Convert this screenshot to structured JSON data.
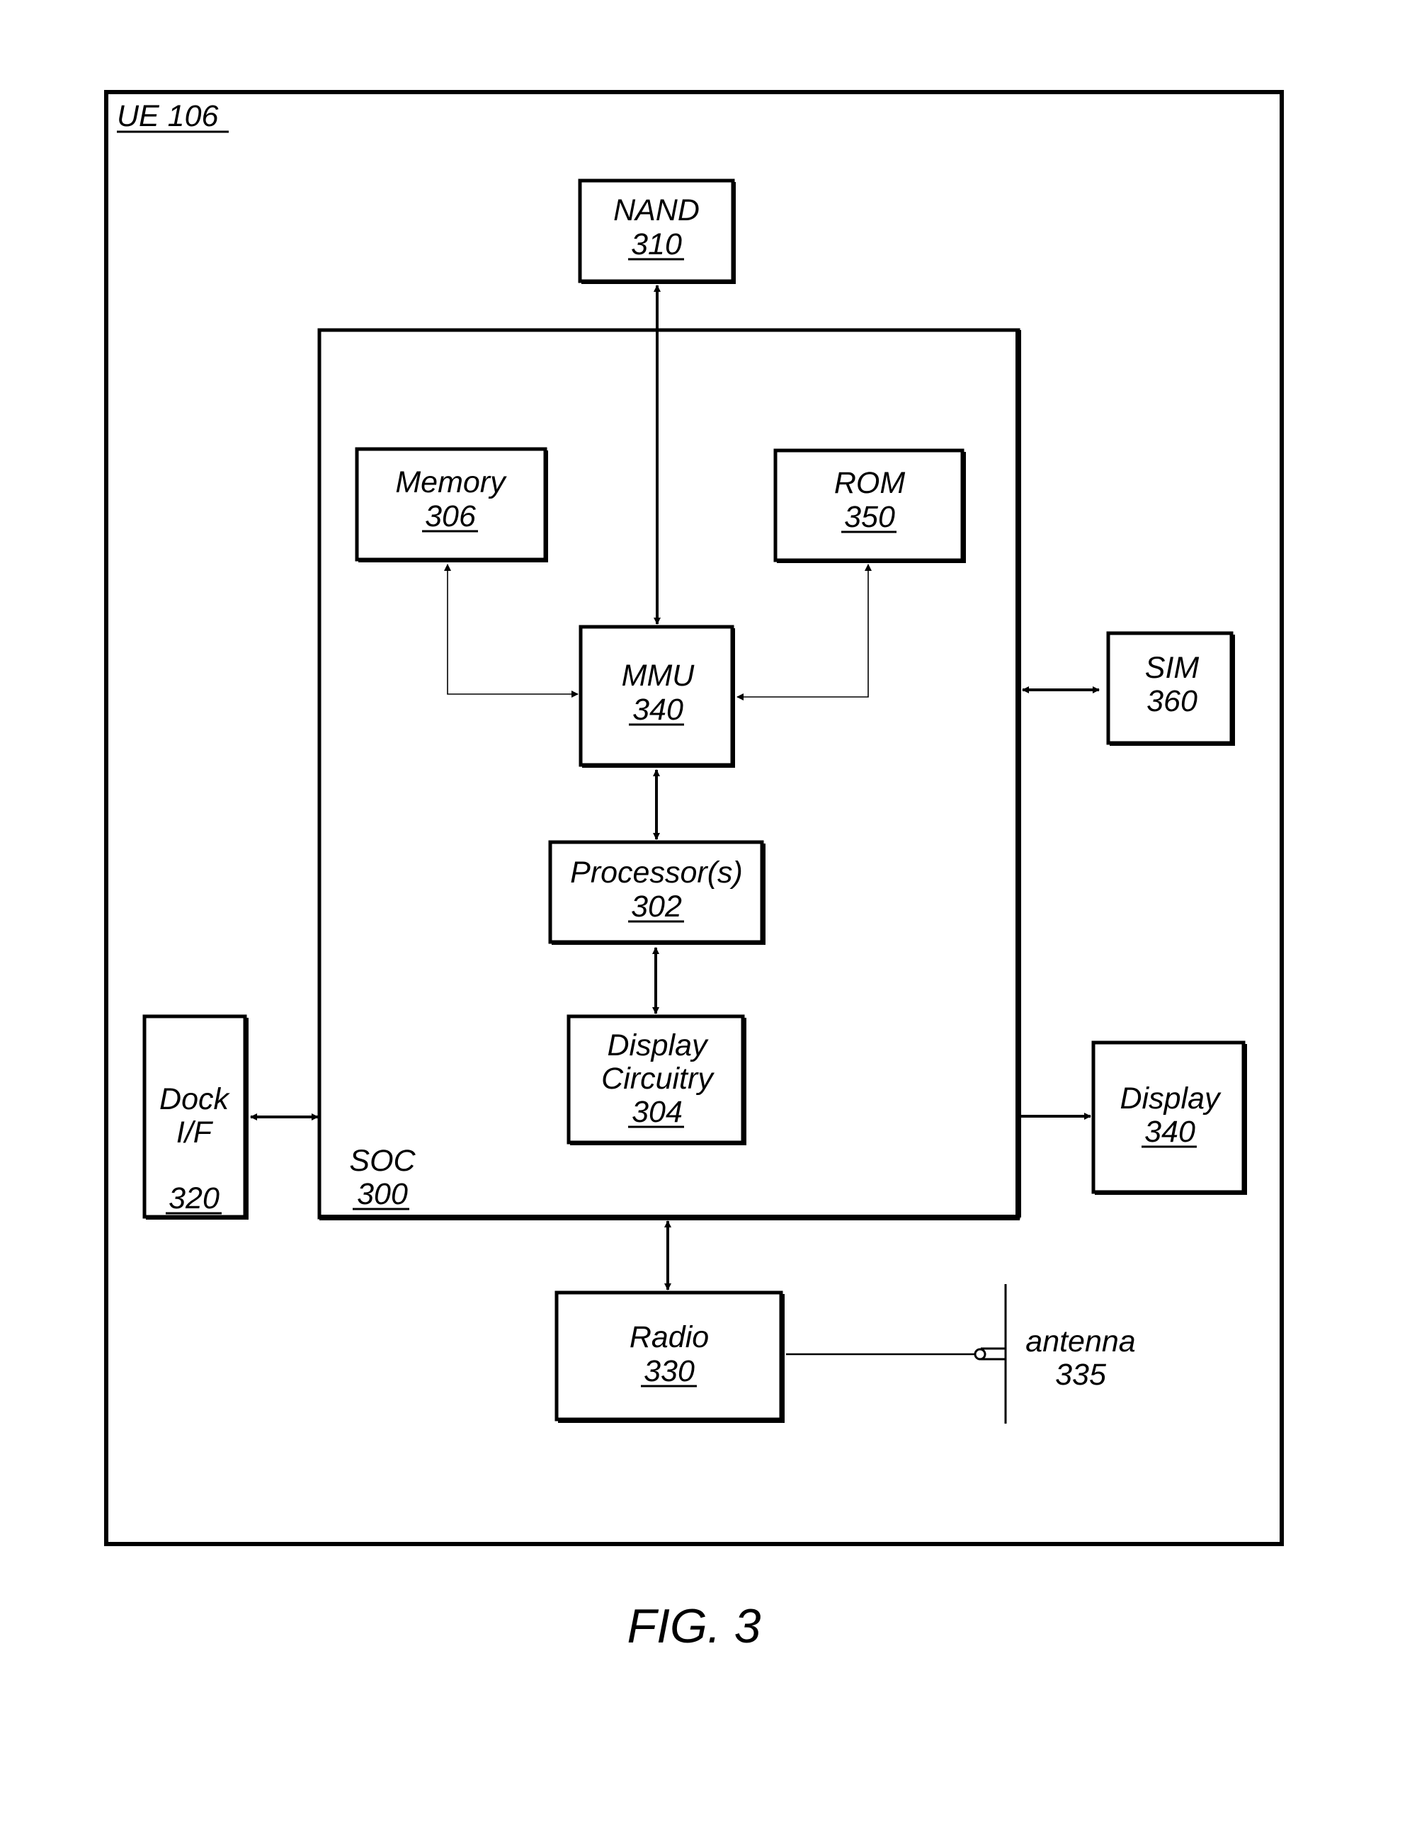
{
  "diagram": {
    "container": {
      "label": "UE 106",
      "label_underlined": true
    },
    "soc": {
      "name": "SOC",
      "ref": "300"
    },
    "blocks": {
      "nand": {
        "name": "NAND",
        "ref": "310",
        "underlined": true
      },
      "memory": {
        "name": "Memory",
        "ref": "306",
        "underlined": true
      },
      "rom": {
        "name": "ROM",
        "ref": "350",
        "underlined": true
      },
      "mmu": {
        "name": "MMU",
        "ref": "340",
        "underlined": true
      },
      "processor": {
        "name": "Processor(s)",
        "ref": "302",
        "underlined": true
      },
      "display_circuitry": {
        "name_line1": "Display",
        "name_line2": "Circuitry",
        "ref": "304",
        "underlined": true
      },
      "sim": {
        "name": "SIM",
        "ref": "360",
        "underlined": false
      },
      "display": {
        "name": "Display",
        "ref": "340",
        "underlined": true
      },
      "dock": {
        "name_line1": "Dock",
        "name_line2": "I/F",
        "ref": "320",
        "underlined": true
      },
      "radio": {
        "name": "Radio",
        "ref": "330",
        "underlined": true
      },
      "antenna": {
        "name": "antenna",
        "ref": "335",
        "underlined": false
      }
    },
    "connections": [
      {
        "from": "NAND 310",
        "to": "MMU 340",
        "type": "bidirectional"
      },
      {
        "from": "Memory 306",
        "to": "MMU 340",
        "type": "bidirectional"
      },
      {
        "from": "ROM 350",
        "to": "MMU 340",
        "type": "bidirectional"
      },
      {
        "from": "MMU 340",
        "to": "Processor(s) 302",
        "type": "bidirectional"
      },
      {
        "from": "Processor(s) 302",
        "to": "Display Circuitry 304",
        "type": "bidirectional"
      },
      {
        "from": "SOC 300",
        "to": "SIM 360",
        "type": "bidirectional"
      },
      {
        "from": "SOC 300",
        "to": "Display 340",
        "type": "unidirectional"
      },
      {
        "from": "Dock I/F 320",
        "to": "SOC 300",
        "type": "bidirectional"
      },
      {
        "from": "SOC 300",
        "to": "Radio 330",
        "type": "bidirectional"
      },
      {
        "from": "Radio 330",
        "to": "antenna 335",
        "type": "line"
      }
    ],
    "caption": "FIG. 3"
  }
}
